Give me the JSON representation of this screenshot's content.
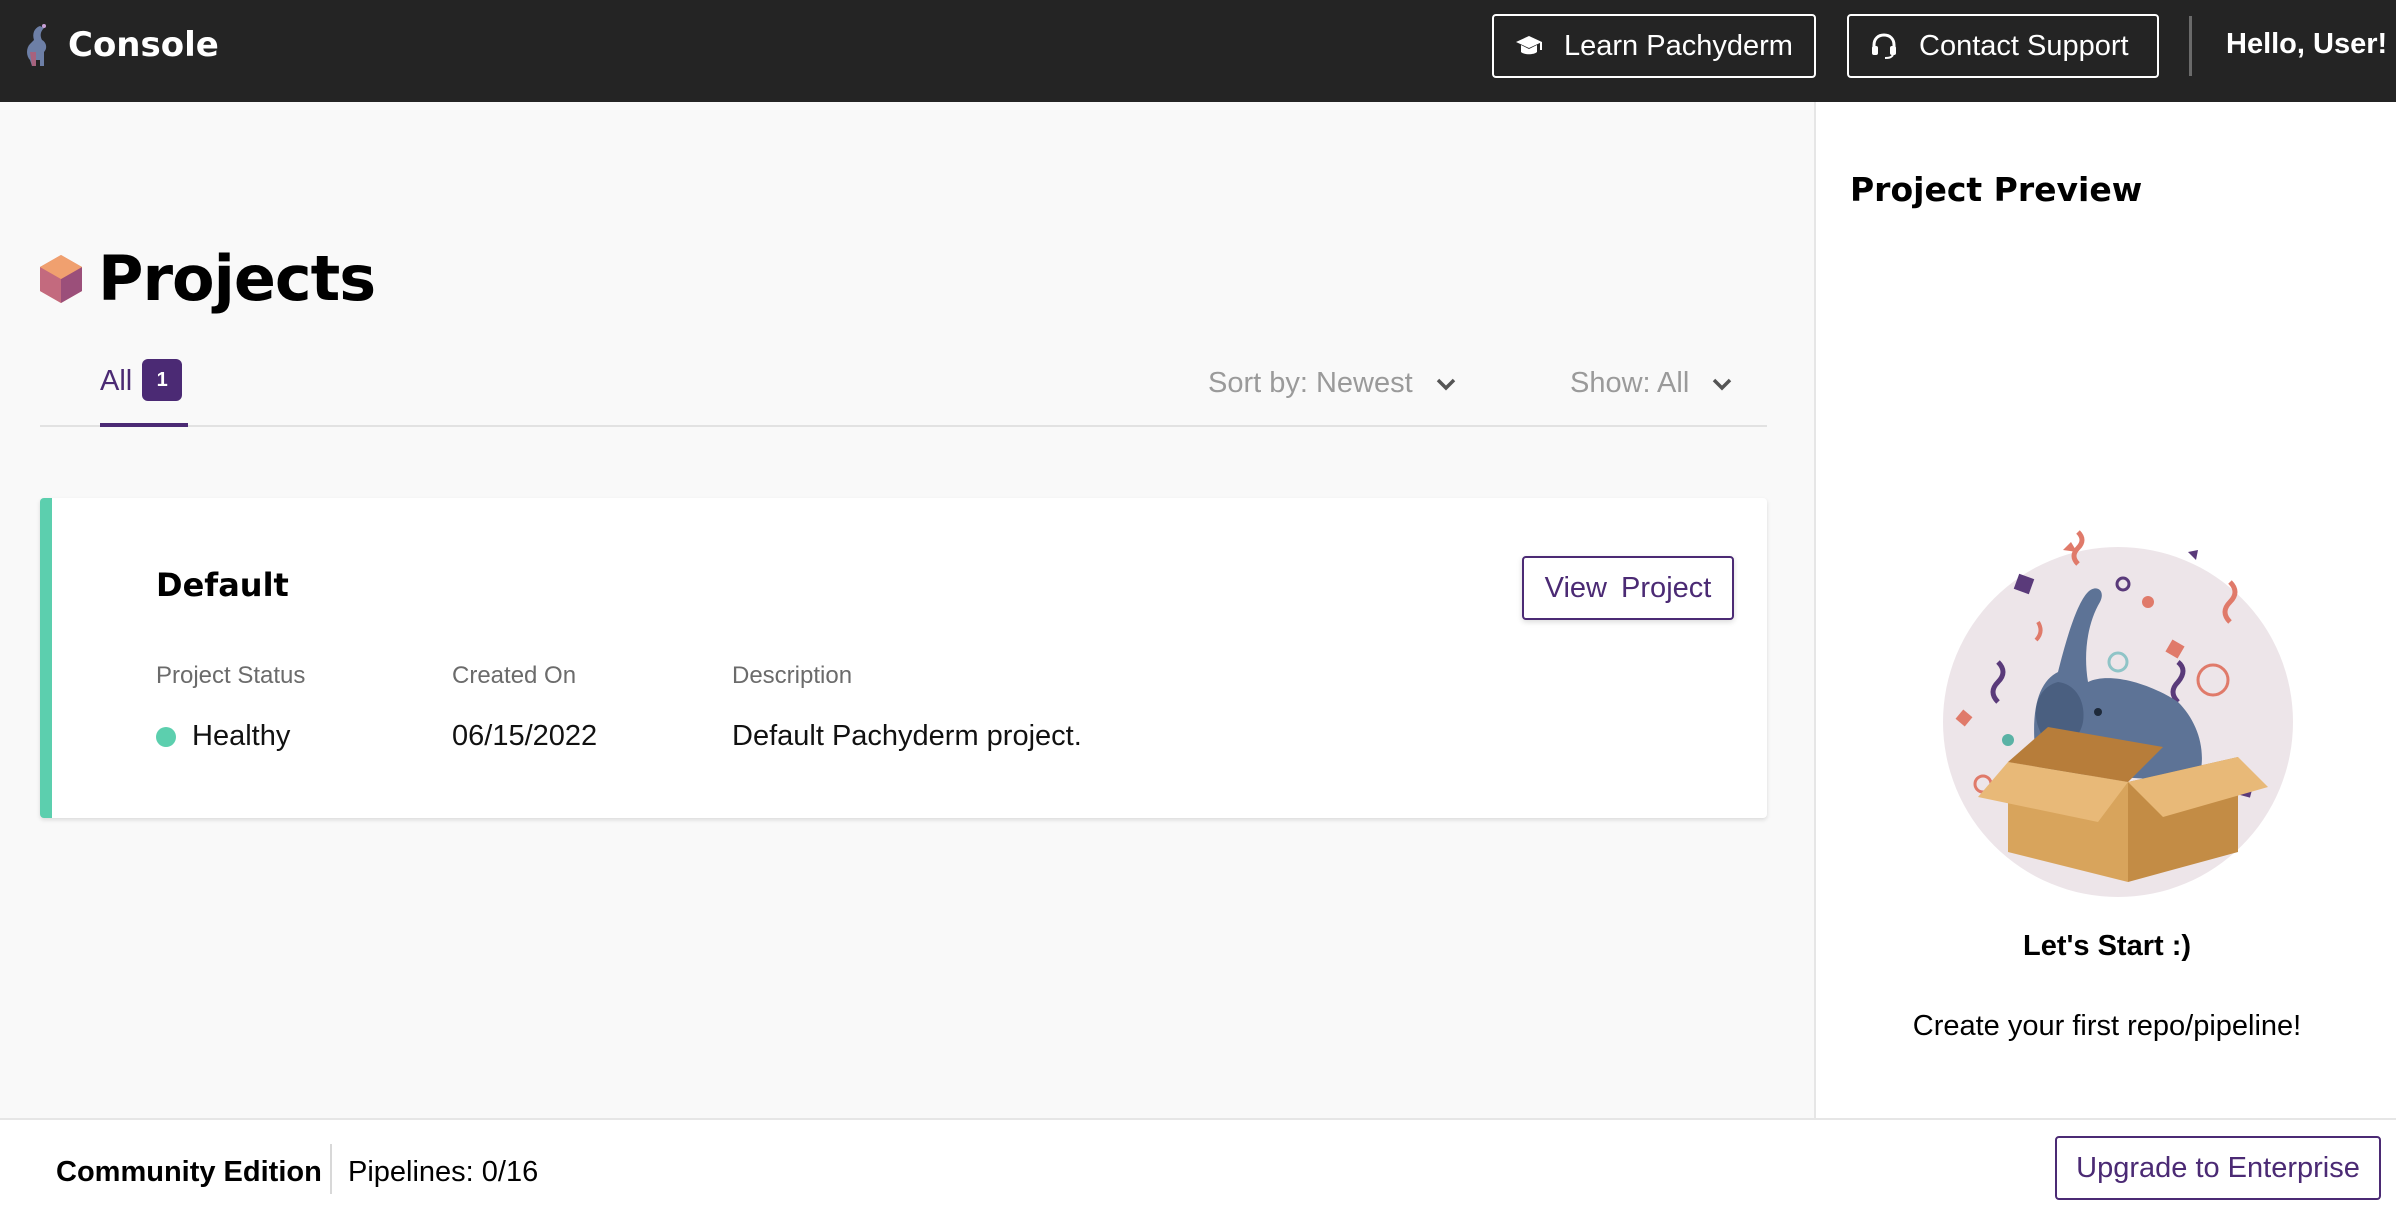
{
  "header": {
    "app_name": "Console",
    "learn_label": "Learn Pachyderm",
    "support_label": "Contact Support",
    "greeting": "Hello, User!"
  },
  "main": {
    "title": "Projects",
    "tabs": [
      {
        "label": "All",
        "count": "1"
      }
    ],
    "sort_label": "Sort by: Newest",
    "show_label": "Show: All"
  },
  "project": {
    "name": "Default",
    "view_label": "View  Project",
    "columns": [
      "Project Status",
      "Created On",
      "Description"
    ],
    "status": "Healthy",
    "created_on": "06/15/2022",
    "description": "Default Pachyderm project."
  },
  "preview": {
    "title": "Project Preview",
    "headline": "Let's Start :)",
    "subtext": "Create your first repo/pipeline!"
  },
  "footer": {
    "edition": "Community Edition",
    "pipelines": "Pipelines: 0/16",
    "upgrade_label": "Upgrade to Enterprise"
  },
  "colors": {
    "header_bg": "#242424",
    "accent_purple": "#4b2a74",
    "healthy_green": "#5ccfae"
  },
  "icons": [
    "pachyderm-logo-icon",
    "graduation-cap-icon",
    "headset-icon",
    "project-cube-icon",
    "chevron-down-icon",
    "elephant-box-illustration"
  ]
}
